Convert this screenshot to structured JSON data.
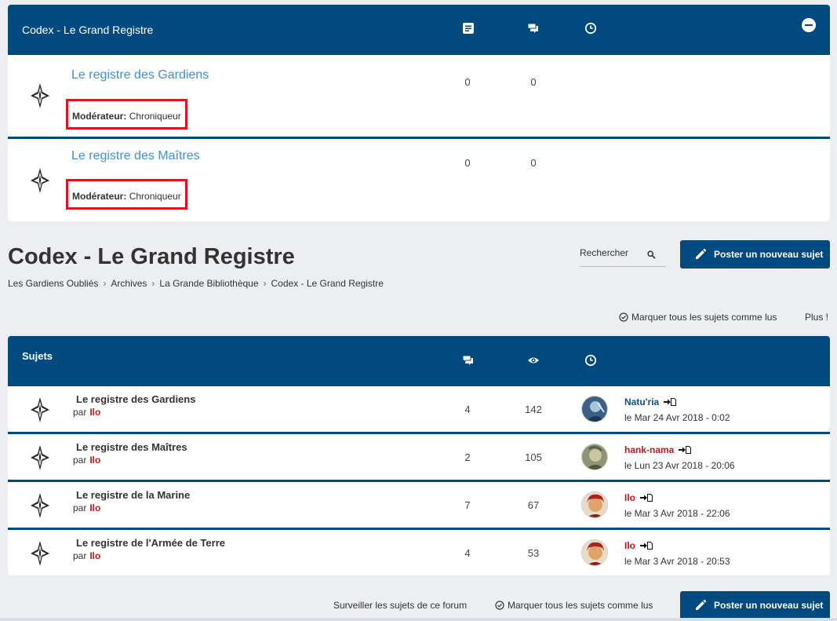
{
  "forums_panel": {
    "title": "Codex - Le Grand Registre",
    "header_icons": [
      "topics-icon",
      "posts-icon",
      "clock-icon",
      "collapse-icon"
    ],
    "forums": [
      {
        "title": "Le registre des Gardiens",
        "moderator_label": "Modérateur:",
        "moderator": "Chroniqueur",
        "topics": "0",
        "posts": "0"
      },
      {
        "title": "Le registre des Maîtres",
        "moderator_label": "Modérateur:",
        "moderator": "Chroniqueur",
        "topics": "0",
        "posts": "0"
      }
    ]
  },
  "page": {
    "title": "Codex - Le Grand Registre",
    "search_placeholder": "Rechercher",
    "post_button": "Poster un nouveau sujet",
    "breadcrumbs": [
      "Les Gardiens Oubliés",
      "Archives",
      "La Grande Bibliothèque",
      "Codex - Le Grand Registre"
    ],
    "mark_all_read": "Marquer tous les sujets comme lus",
    "more": "Plus !"
  },
  "topics_panel": {
    "title": "Sujets",
    "header_icons": [
      "replies-icon",
      "views-icon",
      "clock-icon"
    ],
    "by_label": "par",
    "topics": [
      {
        "title": "Le registre des Gardiens",
        "author": "Ilo",
        "replies": "4",
        "views": "142",
        "last_user": "Natu'ria",
        "last_user_color": "#104f87",
        "last_date": "le Mar 24 Avr 2018 - 0:02"
      },
      {
        "title": "Le registre des Maîtres",
        "author": "Ilo",
        "replies": "2",
        "views": "105",
        "last_user": "hank-nama",
        "last_user_color": "#c8141a",
        "last_date": "le Lun 23 Avr 2018 - 20:06"
      },
      {
        "title": "Le registre de la Marine",
        "author": "Ilo",
        "replies": "7",
        "views": "67",
        "last_user": "Ilo",
        "last_user_color": "#c8141a",
        "last_date": "le Mar 3 Avr 2018 - 22:06"
      },
      {
        "title": "Le registre de l'Armée de Terre",
        "author": "Ilo",
        "replies": "4",
        "views": "53",
        "last_user": "Ilo",
        "last_user_color": "#c8141a",
        "last_date": "le Mar 3 Avr 2018 - 20:53"
      }
    ]
  },
  "footer": {
    "watch_topics": "Surveiller les sujets de ce forum",
    "mark_all_read": "Marquer tous les sujets comme lus",
    "post_button": "Poster un nouveau sujet"
  },
  "colors": {
    "header_blue": "#004a80",
    "link_blue": "#3d8fd6",
    "highlight_red": "#e0141e",
    "author_red": "#c8141a"
  }
}
